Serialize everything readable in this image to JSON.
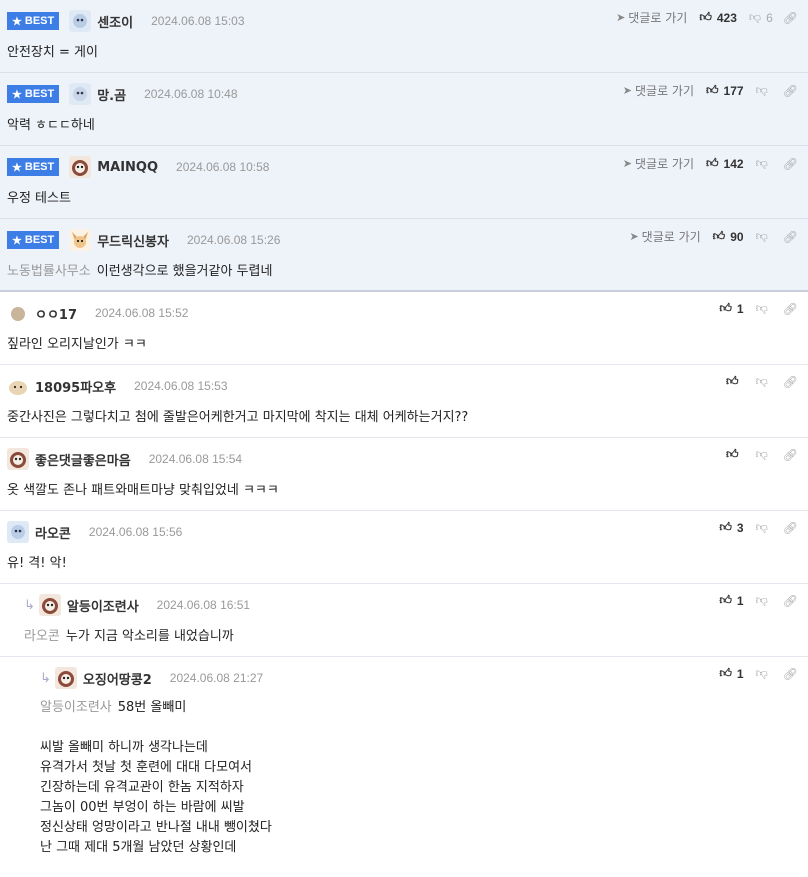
{
  "best_label": "BEST",
  "goto_label": "댓글로 가기",
  "best": [
    {
      "nick": "센조이",
      "date": "2024.06.08 15:03",
      "body": "안전장치 = 게이",
      "likes": "423",
      "dislikes": "6",
      "mention": ""
    },
    {
      "nick": "망.곰",
      "date": "2024.06.08 10:48",
      "body": "악력 ㅎㄷㄷ하네",
      "likes": "177",
      "dislikes": "",
      "mention": ""
    },
    {
      "nick": "MAINQQ",
      "date": "2024.06.08 10:58",
      "body": "우정 테스트",
      "likes": "142",
      "dislikes": "",
      "mention": ""
    },
    {
      "nick": "무드릭신봉자",
      "date": "2024.06.08 15:26",
      "body": "이런생각으로 했을거같아 두렵네",
      "likes": "90",
      "dislikes": "",
      "mention": "노동법률사무소"
    }
  ],
  "comments": [
    {
      "nick": "ㅇㅇ17",
      "date": "2024.06.08 15:52",
      "body": "짚라인 오리지날인가 ㅋㅋ",
      "likes": "1"
    },
    {
      "nick": "18095파오후",
      "date": "2024.06.08 15:53",
      "body": "중간사진은 그렇다치고 첨에 줄발은어케한거고 마지막에 착지는 대체 어케하는거지??",
      "likes": ""
    },
    {
      "nick": "좋은댓글좋은마음",
      "date": "2024.06.08 15:54",
      "body": "옷 색깔도 존나 패트와매트마냥 맞춰입었네 ㅋㅋㅋ",
      "likes": ""
    },
    {
      "nick": "라오콘",
      "date": "2024.06.08 15:56",
      "body": "유! 격! 악!",
      "likes": "3"
    }
  ],
  "reply1": {
    "nick": "알등이조련사",
    "date": "2024.06.08 16:51",
    "mention": "라오콘",
    "body": "누가 지금 악소리를 내었습니까",
    "likes": "1"
  },
  "reply2": {
    "nick": "오징어땅콩2",
    "date": "2024.06.08 21:27",
    "mention": "알등이조련사",
    "likes": "1",
    "lines": [
      "58번 올빼미",
      "",
      "씨발 올빼미 하니까 생각나는데",
      "유격가서 첫날 첫 훈련에 대대 다모여서",
      "긴장하는데 유격교관이 한놈 지적하자",
      "그놈이 00번 부엉이 하는 바람에 씨발",
      "정신상태 엉망이라고 반나절 내내 뺑이쳤다",
      "난 그때 제대 5개월 남았던 상황인데"
    ]
  },
  "icons": {
    "like": "thumbs-up-icon",
    "dislike": "thumbs-down-icon",
    "share": "link-icon",
    "goto": "arrow-icon",
    "star": "star-icon"
  },
  "colors": {
    "best_bg": "#eef2f9",
    "badge": "#3c7ee6"
  }
}
